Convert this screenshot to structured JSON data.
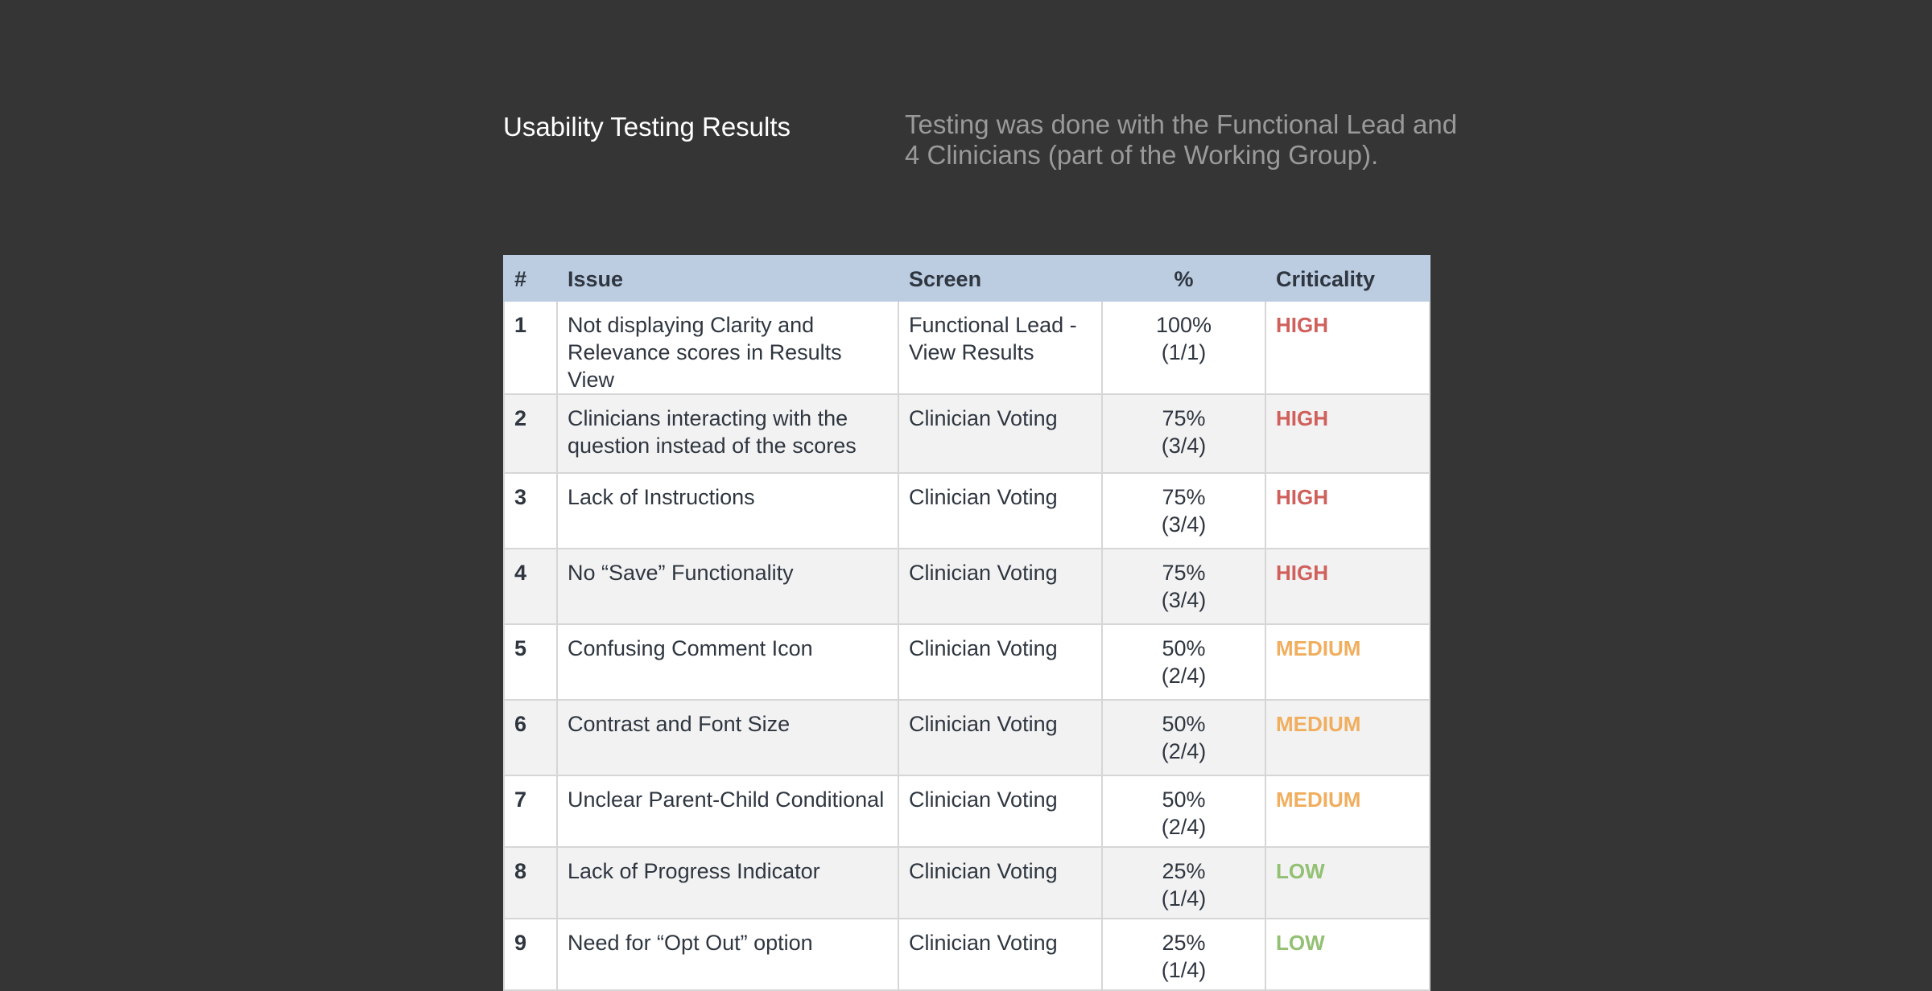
{
  "page": {
    "title": "Usability Testing Results",
    "subtitle": "Testing was done with the Functional Lead and 4 Clinicians (part of the Working Group)."
  },
  "table": {
    "headers": {
      "num": "#",
      "issue": "Issue",
      "screen": "Screen",
      "pct": "%",
      "criticality": "Criticality"
    },
    "rows": [
      {
        "num": "1",
        "issue": "Not displaying Clarity and Relevance scores in Results View",
        "screen": "Functional Lead - View Results",
        "pct": "100%",
        "ratio": "(1/1)",
        "criticality": "HIGH"
      },
      {
        "num": "2",
        "issue": "Clinicians interacting with the question instead of the scores",
        "screen": "Clinician Voting",
        "pct": "75%",
        "ratio": "(3/4)",
        "criticality": "HIGH"
      },
      {
        "num": "3",
        "issue": "Lack of Instructions",
        "screen": "Clinician Voting",
        "pct": "75%",
        "ratio": "(3/4)",
        "criticality": "HIGH"
      },
      {
        "num": "4",
        "issue": "No “Save” Functionality",
        "screen": "Clinician Voting",
        "pct": "75%",
        "ratio": "(3/4)",
        "criticality": "HIGH"
      },
      {
        "num": "5",
        "issue": "Confusing Comment Icon",
        "screen": "Clinician Voting",
        "pct": "50%",
        "ratio": "(2/4)",
        "criticality": "MEDIUM"
      },
      {
        "num": "6",
        "issue": "Contrast and Font Size",
        "screen": "Clinician Voting",
        "pct": "50%",
        "ratio": "(2/4)",
        "criticality": "MEDIUM"
      },
      {
        "num": "7",
        "issue": "Unclear Parent-Child Conditional",
        "screen": "Clinician Voting",
        "pct": "50%",
        "ratio": "(2/4)",
        "criticality": "MEDIUM"
      },
      {
        "num": "8",
        "issue": "Lack of Progress Indicator",
        "screen": "Clinician Voting",
        "pct": "25%",
        "ratio": "(1/4)",
        "criticality": "LOW"
      },
      {
        "num": "9",
        "issue": "Need for “Opt Out” option",
        "screen": "Clinician Voting",
        "pct": "25%",
        "ratio": "(1/4)",
        "criticality": "LOW"
      }
    ]
  },
  "colors": {
    "background": "#353535",
    "header_bg": "#bccde2",
    "high": "#d0605c",
    "medium": "#f0ae5e",
    "low": "#93c073"
  }
}
